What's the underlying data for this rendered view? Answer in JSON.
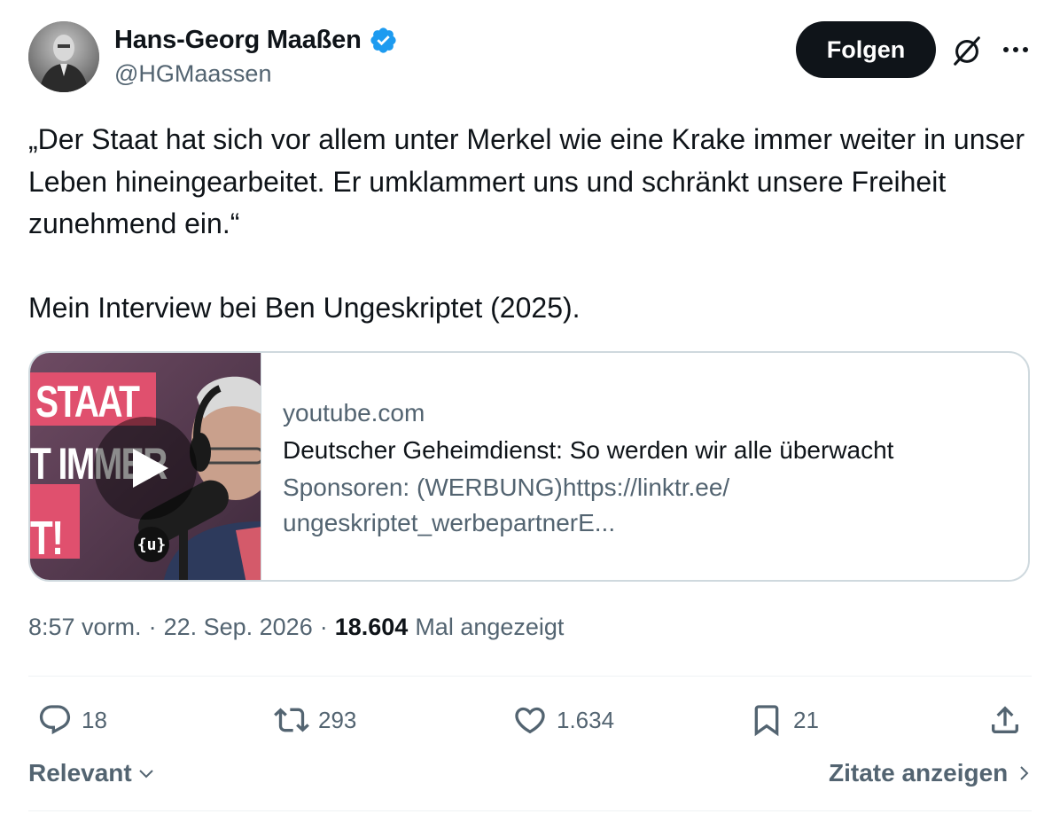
{
  "author": {
    "name": "Hans-Georg Maaßen",
    "handle": "@HGMaassen",
    "verified": true
  },
  "header": {
    "follow_label": "Folgen",
    "grok_icon": "slashed-circle-icon",
    "more_icon": "more-icon"
  },
  "tweet": {
    "paragraphs": [
      "„Der Staat hat sich vor allem unter Merkel wie eine Krake immer weiter in unser Leben hineingearbeitet. Er umklammert uns und schränkt unsere Freiheit zunehmend ein.“",
      "Mein Interview bei Ben Ungeskriptet (2025)."
    ]
  },
  "card": {
    "thumbnail": {
      "overlay_line1": "STAAT",
      "overlay_line2": "T IMMER",
      "overlay_line3": "T!",
      "logo_text": "{u}"
    },
    "domain": "youtube.com",
    "title": "Deutscher Geheimdienst: So werden wir alle überwacht",
    "description": "Sponsoren: (WERBUNG)https://linktr.ee/ ungeskriptet_werbepartnerE..."
  },
  "meta": {
    "time": "8:57 vorm.",
    "separator": "·",
    "date": "22. Sep. 2026",
    "views_count": "18.604",
    "views_label": "Mal angezeigt"
  },
  "actions": {
    "replies": "18",
    "reposts": "293",
    "likes": "1.634",
    "bookmarks": "21"
  },
  "footer": {
    "sort_label": "Relevant",
    "quotes_label": "Zitate anzeigen"
  },
  "colors": {
    "accent_verified": "#1d9bf0",
    "text_primary": "#0f1419",
    "text_secondary": "#536471",
    "border": "#cfd9de",
    "thumbnail_pink": "#e0506e"
  }
}
